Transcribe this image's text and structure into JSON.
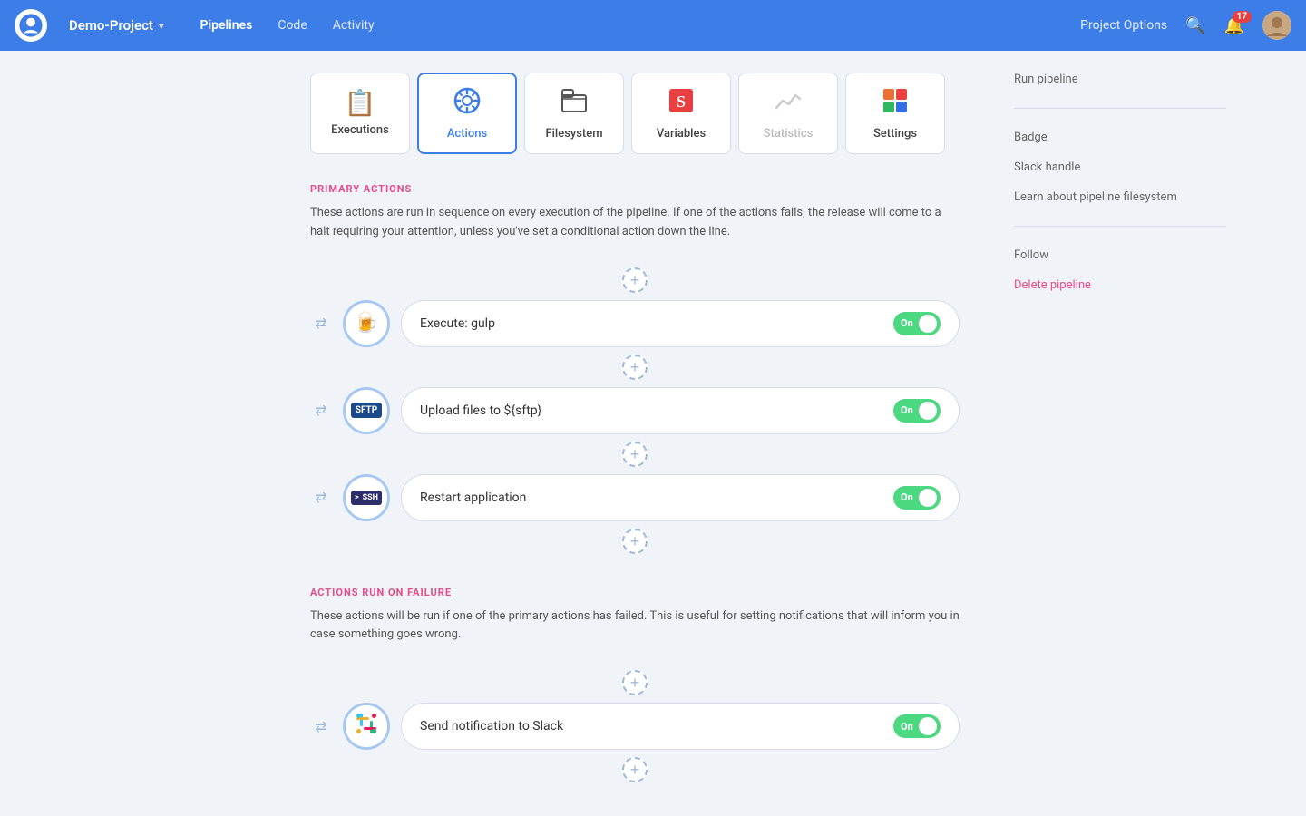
{
  "nav": {
    "project_name": "Demo-Project",
    "links": [
      "Pipelines",
      "Code",
      "Activity"
    ],
    "active_link": "Pipelines",
    "project_options": "Project Options",
    "notification_count": "17"
  },
  "tabs": [
    {
      "id": "executions",
      "label": "Executions",
      "icon": "📋",
      "active": false,
      "disabled": false
    },
    {
      "id": "actions",
      "label": "Actions",
      "icon": "⚙️",
      "active": true,
      "disabled": false
    },
    {
      "id": "filesystem",
      "label": "Filesystem",
      "icon": "📁",
      "active": false,
      "disabled": false
    },
    {
      "id": "variables",
      "label": "Variables",
      "icon": "🅢",
      "active": false,
      "disabled": false
    },
    {
      "id": "statistics",
      "label": "Statistics",
      "icon": "📈",
      "active": false,
      "disabled": true
    },
    {
      "id": "settings",
      "label": "Settings",
      "icon": "🔷",
      "active": false,
      "disabled": false
    }
  ],
  "primary_actions": {
    "section_label": "PRIMARY ACTIONS",
    "description": "These actions are run in sequence on every execution of the pipeline. If one of the actions fails, the release will come to a halt requiring your attention, unless you've set a conditional action down the line.",
    "items": [
      {
        "id": "gulp",
        "label": "Execute: gulp",
        "icon_type": "gulp",
        "toggle": "On"
      },
      {
        "id": "sftp",
        "label": "Upload files to ${sftp}",
        "icon_type": "sftp",
        "toggle": "On"
      },
      {
        "id": "ssh",
        "label": "Restart application",
        "icon_type": "ssh",
        "toggle": "On"
      }
    ]
  },
  "failure_actions": {
    "section_label": "ACTIONS RUN ON FAILURE",
    "description": "These actions will be run if one of the primary actions has failed. This is useful for setting notifications that will inform you in case something goes wrong.",
    "items": [
      {
        "id": "slack",
        "label": "Send notification to Slack",
        "icon_type": "slack",
        "toggle": "On"
      }
    ]
  },
  "sidebar": {
    "links": [
      {
        "id": "run-pipeline",
        "label": "Run pipeline",
        "danger": false
      },
      {
        "id": "badge",
        "label": "Badge",
        "danger": false
      },
      {
        "id": "slack-handle",
        "label": "Slack handle",
        "danger": false
      },
      {
        "id": "learn-filesystem",
        "label": "Learn about pipeline filesystem",
        "danger": false
      },
      {
        "id": "follow",
        "label": "Follow",
        "danger": false
      },
      {
        "id": "delete-pipeline",
        "label": "Delete pipeline",
        "danger": true
      }
    ]
  }
}
